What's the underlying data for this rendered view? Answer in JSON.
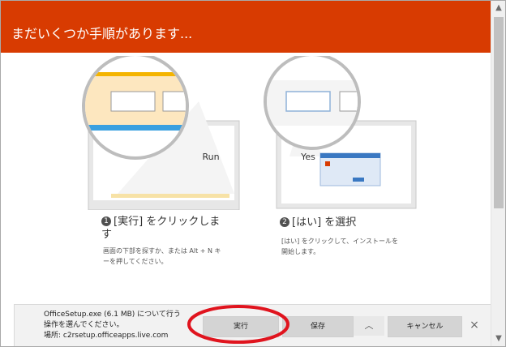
{
  "header": {
    "title": "まだいくつか手順があります..."
  },
  "illustrations": {
    "step1_button_label": "Run",
    "step2_button_label": "Yes"
  },
  "steps": [
    {
      "number": "1",
      "title_line1": "[実行] をクリックしま",
      "title_line2": "す",
      "desc_line1": "画面の下部を探すか、または Alt + N キ",
      "desc_line2": "ーを押してください。"
    },
    {
      "number": "2",
      "title_line1": "[はい] を選択",
      "desc_line1": "[はい] をクリックして、インストールを",
      "desc_line2": "開始します。"
    }
  ],
  "notification": {
    "line1": "OfficeSetup.exe (6.1 MB) について行う",
    "line2": "操作を選んでください。",
    "line3": "場所: c2rsetup.officeapps.live.com",
    "run_label": "実行",
    "save_label": "保存",
    "save_menu_glyph": "︿",
    "cancel_label": "キャンセル",
    "close_glyph": "×"
  },
  "scrollbar": {
    "up_glyph": "▲",
    "down_glyph": "▼"
  },
  "colors": {
    "header": "#d83b01",
    "highlight": "#e0141e"
  }
}
